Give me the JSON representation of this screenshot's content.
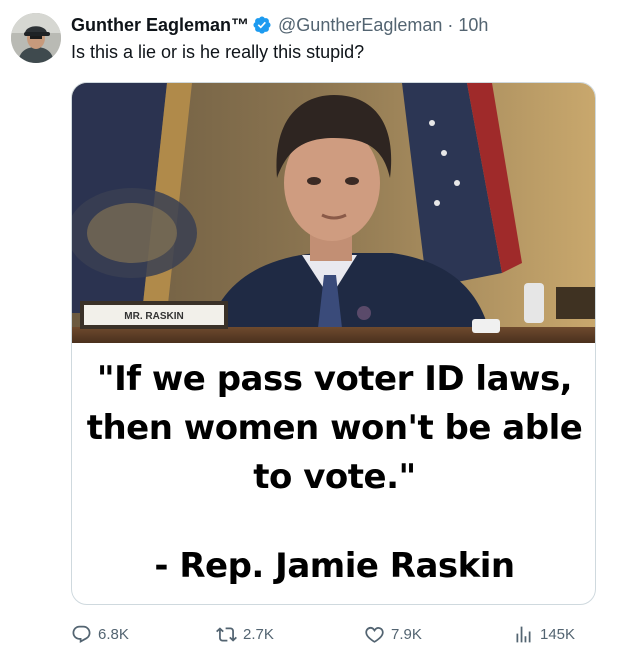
{
  "tweet": {
    "author_name": "Gunther Eagleman™",
    "handle": "@GuntherEagleman",
    "separator": "·",
    "time": "10h",
    "text": "Is this a lie or is he really this stupid?",
    "verified": true
  },
  "media": {
    "nameplate": "MR. RASKIN",
    "quote_lines": [
      "\"If we pass voter ID laws,",
      "then women won't be able",
      "to vote.\""
    ],
    "attribution": "- Rep. Jamie Raskin"
  },
  "actions": {
    "replies": "6.8K",
    "reposts": "2.7K",
    "likes": "7.9K",
    "views": "145K"
  },
  "colors": {
    "text": "#0f1419",
    "secondary": "#536471",
    "verified": "#1d9bf0",
    "border": "#cfd9de"
  },
  "icons": [
    "reply-icon",
    "retweet-icon",
    "like-icon",
    "views-icon",
    "verified-badge-icon"
  ]
}
